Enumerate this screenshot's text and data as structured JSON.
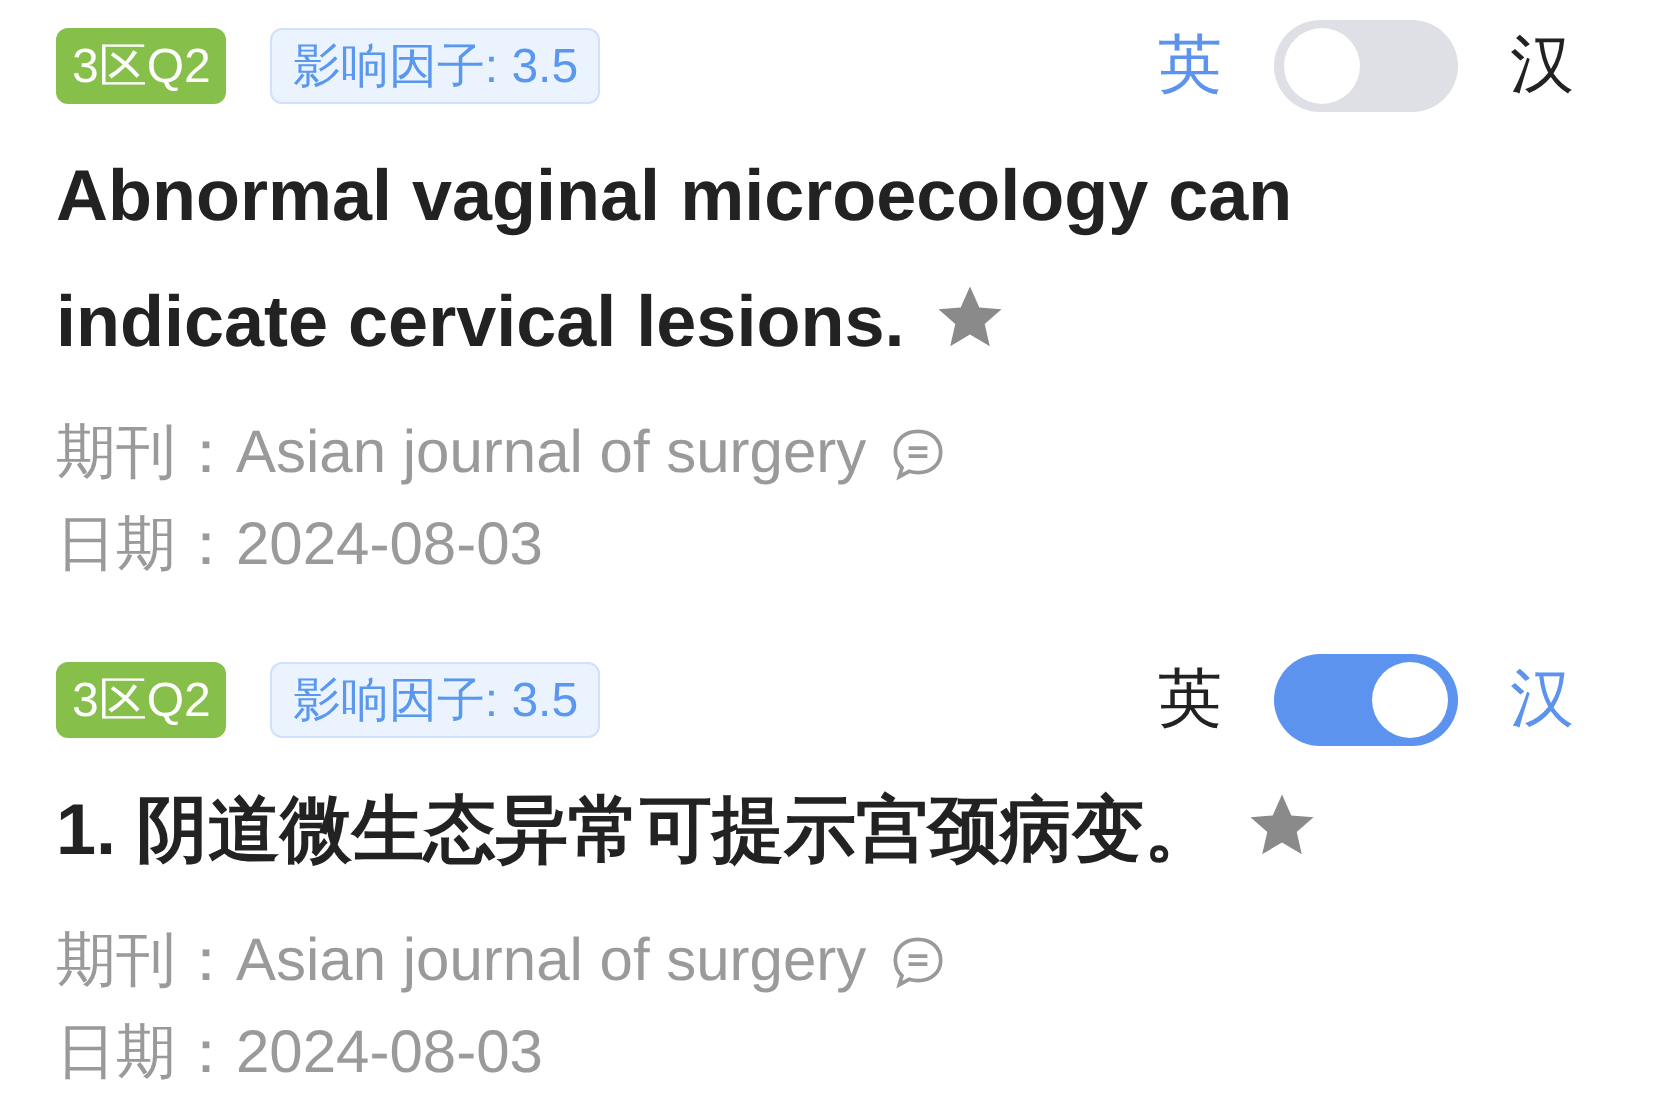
{
  "articles": [
    {
      "zone_tag": "3区Q2",
      "impact_tag": "影响因子: 3.5",
      "lang_left": "英",
      "lang_right": "汉",
      "translate_on": false,
      "title": "Abnormal vaginal microecology can indicate cervical lesions.",
      "starred": false,
      "journal_label": "期刊：",
      "journal": "Asian journal of surgery",
      "date_label": "日期：",
      "date": "2024-08-03"
    },
    {
      "zone_tag": "3区Q2",
      "impact_tag": "影响因子: 3.5",
      "lang_left": "英",
      "lang_right": "汉",
      "translate_on": true,
      "title": "1. 阴道微生态异常可提示宫颈病变。",
      "starred": false,
      "journal_label": "期刊：",
      "journal": "Asian journal of surgery",
      "date_label": "日期：",
      "date": "2024-08-03"
    }
  ]
}
